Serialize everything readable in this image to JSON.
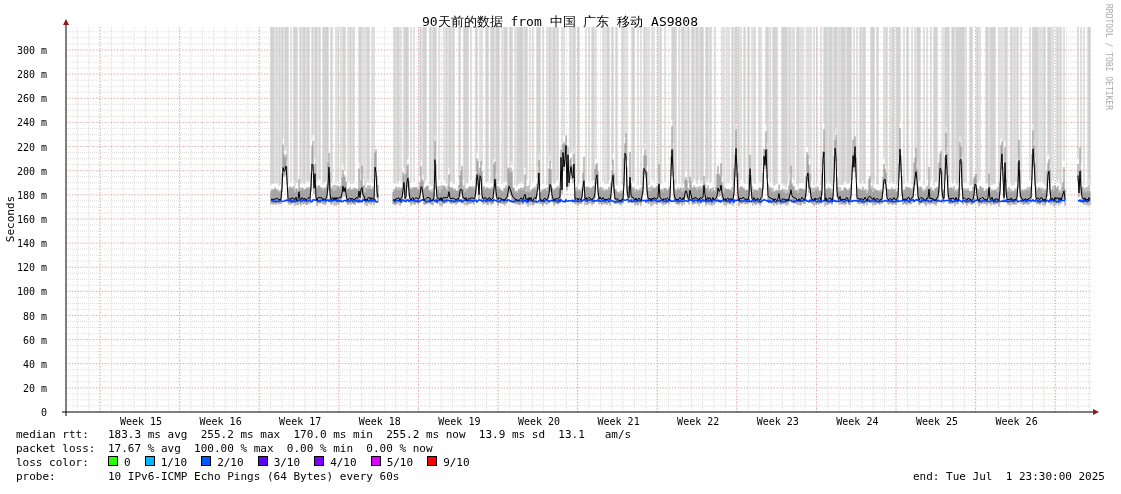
{
  "title": "90天前的数据 from 中国 广东 移动 AS9808",
  "credit": "RRDTOOL / TOBI OETIKER",
  "y_axis": {
    "label": "Seconds",
    "ticks": [
      "300 m",
      "280 m",
      "260 m",
      "240 m",
      "220 m",
      "200 m",
      "180 m",
      "160 m",
      "140 m",
      "120 m",
      "100 m",
      "80 m",
      "60 m",
      "40 m",
      "20 m",
      "0"
    ]
  },
  "x_axis": {
    "ticks": [
      "Week 15",
      "Week 16",
      "Week 17",
      "Week 18",
      "Week 19",
      "Week 20",
      "Week 21",
      "Week 22",
      "Week 23",
      "Week 24",
      "Week 25",
      "Week 26"
    ]
  },
  "legend": {
    "median_rtt": {
      "label": "median rtt:",
      "value": "183.3 ms avg  255.2 ms max  170.0 ms min  255.2 ms now  13.9 ms sd  13.1   am/s"
    },
    "packet_loss": {
      "label": "packet loss:",
      "value": "17.67 % avg  100.00 % max  0.00 % min  0.00 % now"
    },
    "loss_color": {
      "label": "loss color:",
      "items": [
        {
          "label": "0",
          "color": "#26ff00"
        },
        {
          "label": "1/10",
          "color": "#00b8ff"
        },
        {
          "label": "2/10",
          "color": "#0059ff"
        },
        {
          "label": "3/10",
          "color": "#5e00ff"
        },
        {
          "label": "4/10",
          "color": "#7e00ff"
        },
        {
          "label": "5/10",
          "color": "#dd00ff"
        },
        {
          "label": "9/10",
          "color": "#ff0000"
        }
      ]
    },
    "probe": {
      "label": "probe:",
      "value": "10 IPv6-ICMP Echo Pings (64 Bytes) every 60s"
    },
    "end": "end: Tue Jul  1 23:30:00 2025"
  }
}
